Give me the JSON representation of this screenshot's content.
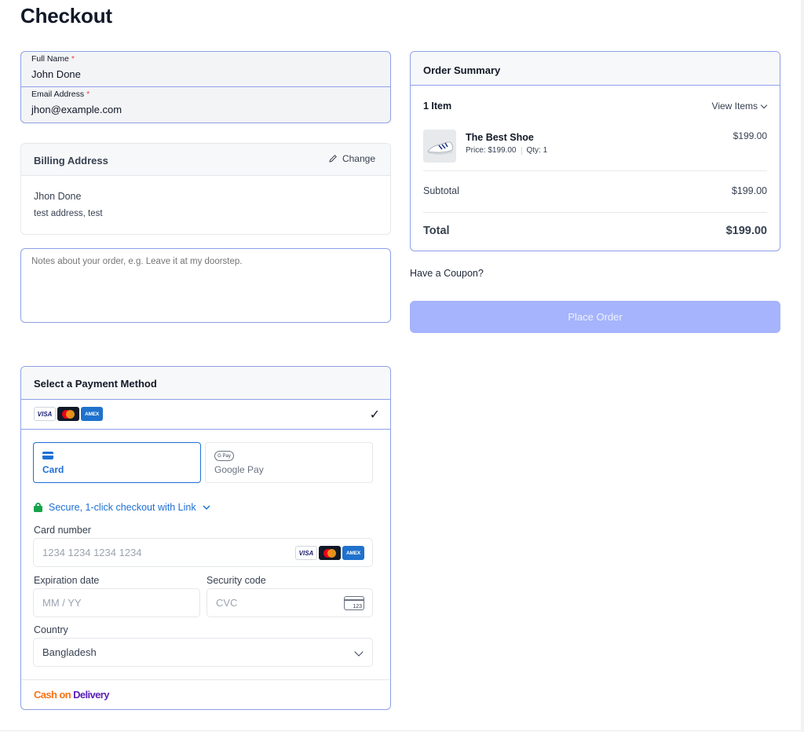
{
  "page": {
    "title": "Checkout"
  },
  "contact": {
    "full_name": {
      "label": "Full Name",
      "required_mark": "*",
      "value": "John Done"
    },
    "email": {
      "label": "Email Address",
      "required_mark": "*",
      "value": "jhon@example.com"
    }
  },
  "billing": {
    "title": "Billing Address",
    "change_label": "Change",
    "name": "Jhon Done",
    "address": "test address, test"
  },
  "notes": {
    "placeholder": "Notes about your order, e.g. Leave it at my doorstep."
  },
  "payment": {
    "title": "Select a Payment Method",
    "card_brands": [
      "VISA",
      "mastercard",
      "AMEX"
    ],
    "selected_mark": "✓",
    "methods": [
      {
        "label": "Card",
        "icon": "credit-card-icon",
        "selected": true
      },
      {
        "label": "Google Pay",
        "icon": "google-pay-icon",
        "selected": false
      }
    ],
    "secure_link_text": "Secure, 1-click checkout with Link",
    "card_number": {
      "label": "Card number",
      "placeholder": "1234 1234 1234 1234"
    },
    "expiration": {
      "label": "Expiration date",
      "placeholder": "MM / YY"
    },
    "security_code": {
      "label": "Security code",
      "placeholder": "CVC",
      "icon_text": "123"
    },
    "country": {
      "label": "Country",
      "value": "Bangladesh"
    },
    "cod": {
      "part1": "Cash on ",
      "part2": "Delivery"
    }
  },
  "summary": {
    "title": "Order Summary",
    "item_count": "1 Item",
    "view_items": "View Items",
    "items": [
      {
        "name": "The Best Shoe",
        "price_text": "Price: $199.00",
        "qty_text": "Qty: 1",
        "line_total": "$199.00"
      }
    ],
    "subtotal_label": "Subtotal",
    "subtotal_value": "$199.00",
    "total_label": "Total",
    "total_value": "$199.00"
  },
  "coupon_text": "Have a Coupon?",
  "place_order_label": "Place Order",
  "colors": {
    "accent": "#1d70d6",
    "border_active": "#8ea0e8",
    "button_disabled": "#a5b4fc",
    "required": "#ef4444"
  }
}
